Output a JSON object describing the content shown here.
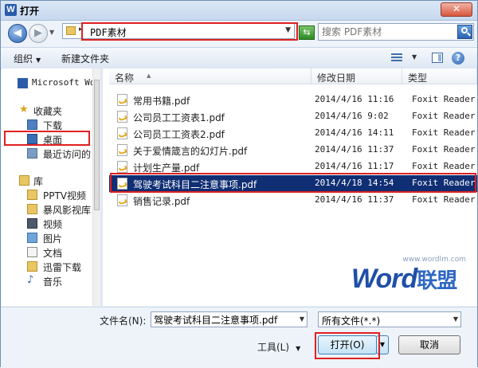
{
  "window": {
    "title": "打开",
    "app_icon": "W",
    "close_label": "✕"
  },
  "nav": {
    "path_label": "PDF素材",
    "search_placeholder": "搜索 PDF素材"
  },
  "toolbar": {
    "organize_label": "组织",
    "new_folder_label": "新建文件夹"
  },
  "sidebar": {
    "items": [
      {
        "label": "Microsoft Wo",
        "icon": "word-icon"
      },
      {
        "label": "收藏夹",
        "icon": "star-icon"
      },
      {
        "label": "下载",
        "icon": "download-folder-icon"
      },
      {
        "label": "桌面",
        "icon": "desktop-icon"
      },
      {
        "label": "最近访问的",
        "icon": "recent-places-icon"
      },
      {
        "label": "库",
        "icon": "library-icon"
      },
      {
        "label": "PPTV视频",
        "icon": "library-folder-icon"
      },
      {
        "label": "暴风影视库",
        "icon": "library-folder-icon"
      },
      {
        "label": "视频",
        "icon": "video-icon"
      },
      {
        "label": "图片",
        "icon": "picture-icon"
      },
      {
        "label": "文档",
        "icon": "document-icon"
      },
      {
        "label": "迅雷下载",
        "icon": "library-folder-icon"
      },
      {
        "label": "音乐",
        "icon": "music-icon"
      }
    ]
  },
  "filelist": {
    "columns": {
      "name": "名称",
      "date": "修改日期",
      "type": "类型"
    },
    "rows": [
      {
        "name": "常用书籍.pdf",
        "date": "2014/4/16 11:16",
        "type": "Foxit Reader D..."
      },
      {
        "name": "公司员工工资表1.pdf",
        "date": "2014/4/16 9:02",
        "type": "Foxit Reader D..."
      },
      {
        "name": "公司员工工资表2.pdf",
        "date": "2014/4/16 14:11",
        "type": "Foxit Reader D..."
      },
      {
        "name": "关于爱情箴言的幻灯片.pdf",
        "date": "2014/4/16 11:37",
        "type": "Foxit Reader D..."
      },
      {
        "name": "计划生产量.pdf",
        "date": "2014/4/16 11:17",
        "type": "Foxit Reader D..."
      },
      {
        "name": "驾驶考试科目二注意事项.pdf",
        "date": "2014/4/18 14:54",
        "type": "Foxit Reader D..."
      },
      {
        "name": "销售记录.pdf",
        "date": "2014/4/16 11:37",
        "type": "Foxit Reader D..."
      }
    ],
    "selected_index": 5
  },
  "watermark": {
    "url": "www.wordlm.com",
    "brand": "Word",
    "brand_cn": "联盟"
  },
  "bottom": {
    "filename_label": "文件名(N):",
    "filename_value": "驾驶考试科目二注意事项.pdf",
    "filetype_value": "所有文件(*.*)",
    "tools_label": "工具(L)",
    "open_label": "打开(O)",
    "cancel_label": "取消"
  },
  "colors": {
    "selection": "#0f2e73",
    "highlight_box": "#e02020",
    "brand_blue": "#1f4fa8"
  }
}
